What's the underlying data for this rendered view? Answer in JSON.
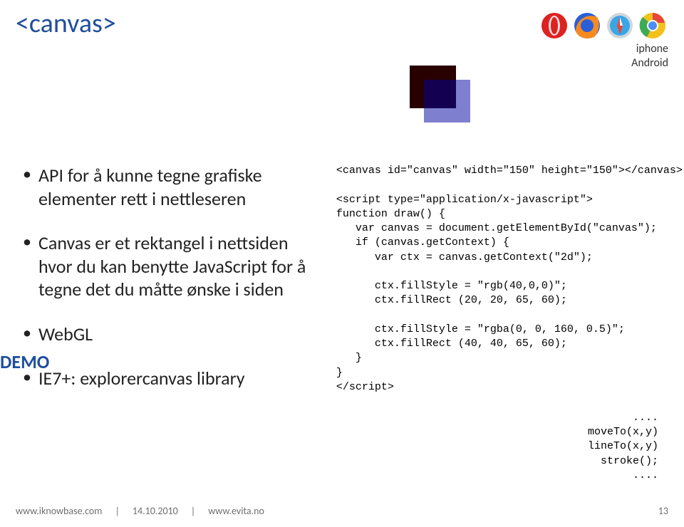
{
  "title": "<canvas>",
  "phone_labels": [
    "iphone",
    "Android"
  ],
  "icons": [
    "opera-icon",
    "firefox-icon",
    "safari-icon",
    "chrome-icon"
  ],
  "bullets": [
    "API for å kunne tegne grafiske elementer rett i nettleseren",
    "Canvas er et rektangel i nettsiden hvor du kan benytte JavaScript for å tegne det du måtte ønske i siden",
    "WebGL",
    "IE7+: explorercanvas library"
  ],
  "demo_label": "DEMO",
  "code": "<canvas id=\"canvas\" width=\"150\" height=\"150\"></canvas>\n\n<script type=\"application/x-javascript\">\nfunction draw() {\n   var canvas = document.getElementById(\"canvas\");\n   if (canvas.getContext) {\n      var ctx = canvas.getContext(\"2d\");\n\n      ctx.fillStyle = \"rgb(40,0,0)\";\n      ctx.fillRect (20, 20, 65, 60);\n\n      ctx.fillStyle = \"rgba(0, 0, 160, 0.5)\";\n      ctx.fillRect (40, 40, 65, 60);\n   }\n}\n</script>",
  "suffix": "....\nmoveTo(x,y)\nlineTo(x,y)\nstroke();\n....",
  "footer": {
    "site1": "www.iknowbase.com",
    "date": "14.10.2010",
    "site2": "www.evita.no",
    "page": "13"
  }
}
